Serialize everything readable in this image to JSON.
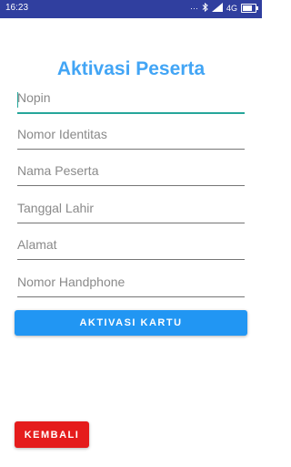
{
  "status_bar": {
    "time": "16:23",
    "icons": [
      "dots-icon",
      "bluetooth-icon",
      "signal-icon",
      "network-type-icon",
      "battery-icon"
    ],
    "network_type": "4G",
    "background": "#303f9f"
  },
  "page": {
    "title": "Aktivasi Peserta",
    "title_color": "#42a5f5"
  },
  "form": {
    "fields": [
      {
        "placeholder": "Nopin",
        "value": ""
      },
      {
        "placeholder": "Nomor Identitas",
        "value": ""
      },
      {
        "placeholder": "Nama Peserta",
        "value": ""
      },
      {
        "placeholder": "Tanggal Lahir",
        "value": ""
      },
      {
        "placeholder": "Alamat",
        "value": ""
      },
      {
        "placeholder": "Nomor Handphone",
        "value": ""
      }
    ],
    "focus_color": "#26a69a"
  },
  "actions": {
    "activate_label": "AKTIVASI KARTU",
    "activate_color": "#2196f3",
    "back_label": "KEMBALI",
    "back_color": "#e51c1c"
  }
}
